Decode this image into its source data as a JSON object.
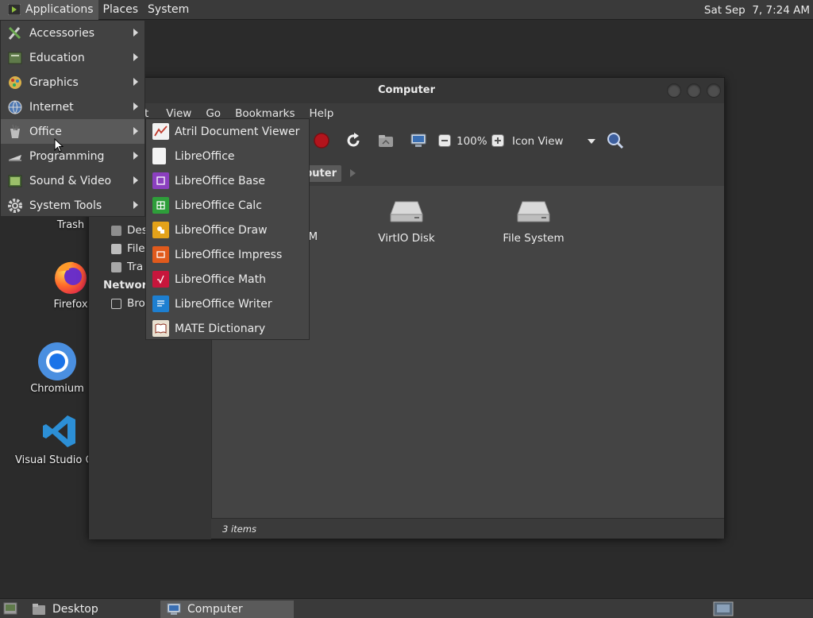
{
  "top_panel": {
    "menus": [
      "Applications",
      "Places",
      "System"
    ],
    "clock": "Sat Sep  7, 7:24 AM"
  },
  "desktop_icons": {
    "trash": "Trash",
    "firefox": "Firefox",
    "chromium": "Chromium",
    "vscode": "Visual Studio Co"
  },
  "window": {
    "title": "Computer",
    "menus": [
      "t",
      "View",
      "Go",
      "Bookmarks",
      "Help"
    ],
    "zoom": "100%",
    "view_mode": "Icon View",
    "breadcrumb": "puter",
    "sidebar": {
      "items": [
        "Des",
        "File",
        "Tra"
      ],
      "network_heading": "Network",
      "network_items": [
        "Bro"
      ]
    },
    "files": [
      "OM",
      "VirtIO Disk",
      "File System"
    ],
    "status": "3 items"
  },
  "applications_menu": {
    "items": [
      "Accessories",
      "Education",
      "Graphics",
      "Internet",
      "Office",
      "Programming",
      "Sound & Video",
      "System Tools"
    ],
    "active_item": "Office"
  },
  "office_submenu": {
    "items": [
      "Atril Document Viewer",
      "LibreOffice",
      "LibreOffice Base",
      "LibreOffice Calc",
      "LibreOffice Draw",
      "LibreOffice Impress",
      "LibreOffice Math",
      "LibreOffice Writer",
      "MATE Dictionary"
    ]
  },
  "bottom_panel": {
    "tasks": [
      "Desktop",
      "Computer"
    ]
  },
  "colors": {
    "panel": "#3a3a3a",
    "menu_highlight": "#5a5a5a",
    "base_blue": "#8b3fbf",
    "calc_green": "#2e9e3a",
    "draw_yellow": "#e3a21a",
    "impress_orange": "#e05a1c",
    "math_red": "#c7163c",
    "writer_blue": "#1d7fd1"
  }
}
